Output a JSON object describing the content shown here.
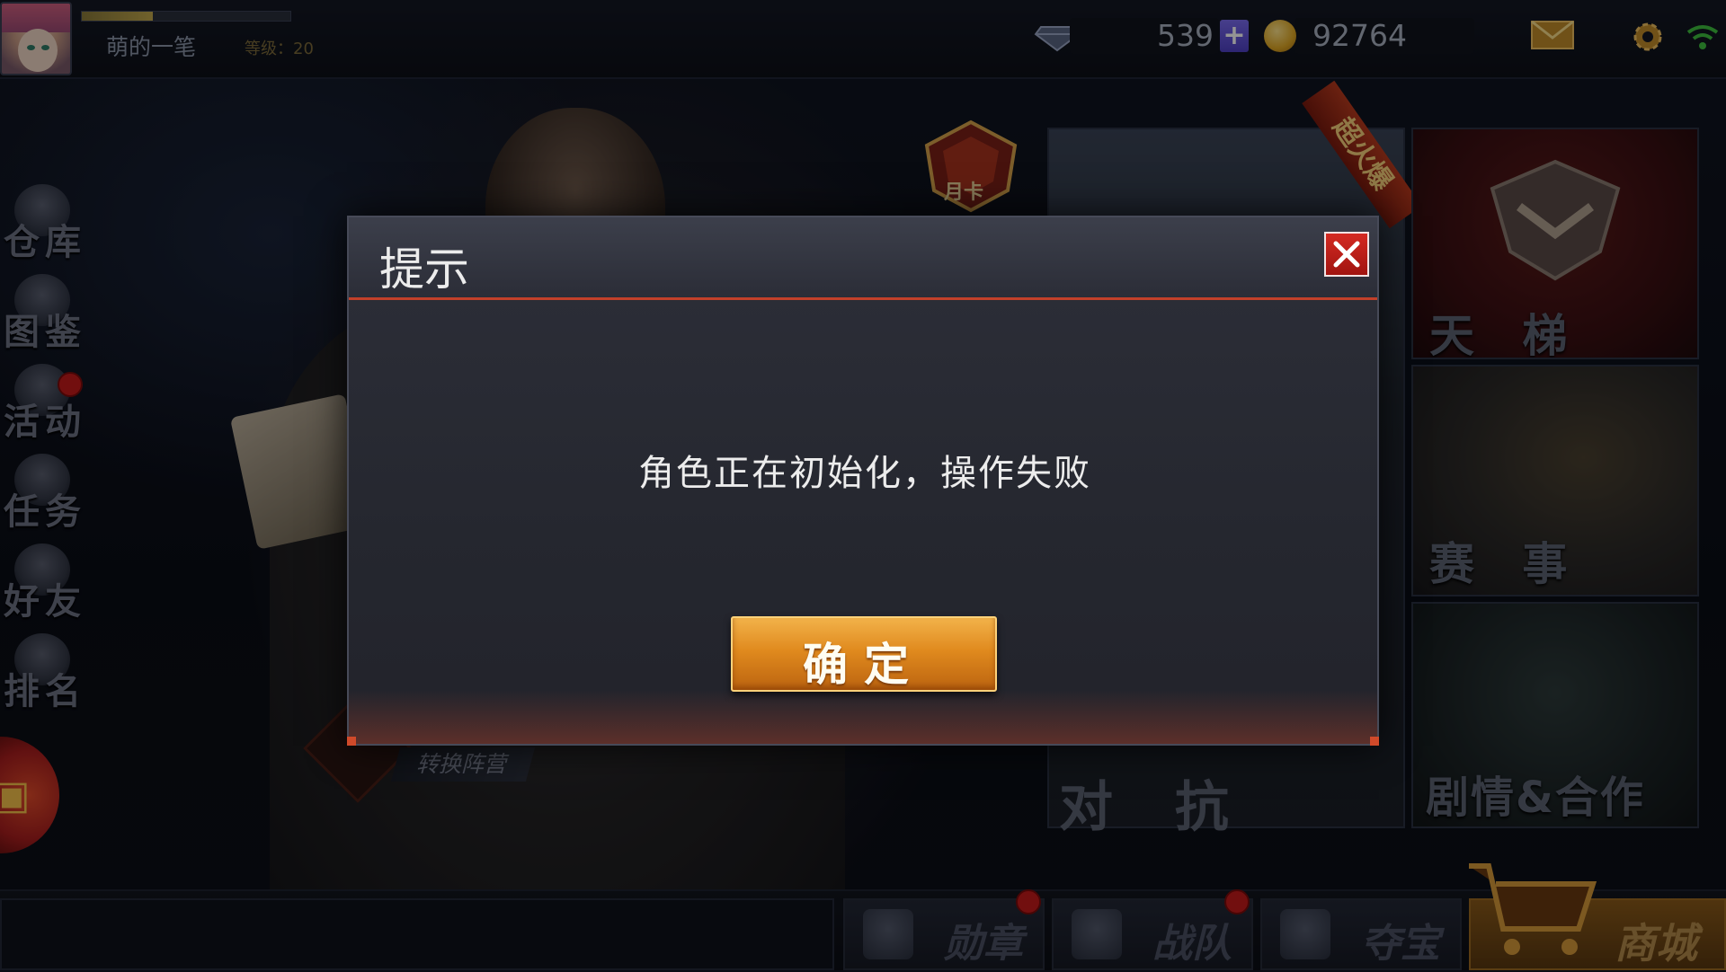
{
  "player": {
    "name": "萌的一笔",
    "level_text": "等级：20",
    "xp_fraction": 0.34
  },
  "currency": {
    "gems": "539",
    "coins": "92764"
  },
  "sidebar": {
    "items": [
      {
        "label": "仓库",
        "icon": "warehouse-icon"
      },
      {
        "label": "图鉴",
        "icon": "handbook-icon"
      },
      {
        "label": "活动",
        "icon": "event-icon"
      },
      {
        "label": "任务",
        "icon": "task-icon"
      },
      {
        "label": "好友",
        "icon": "friends-icon"
      },
      {
        "label": "排名",
        "icon": "ranking-icon"
      }
    ]
  },
  "main": {
    "month_card": "月卡",
    "switch_camp": "转换阵营",
    "fire_badge": "超火爆",
    "modes": {
      "duikang": "对 抗",
      "tianti": "天 梯",
      "saishi": "赛 事",
      "story": "剧情&合作"
    }
  },
  "bottom": {
    "medal": "勋章",
    "team": "战队",
    "treasure": "夺宝",
    "shop": "商城"
  },
  "dialog": {
    "title": "提示",
    "message": "角色正在初始化，操作失败",
    "confirm": "确定"
  },
  "colors": {
    "accent_orange": "#e08a1e",
    "close_red": "#d42a22",
    "notify_red": "#c51a1a"
  }
}
